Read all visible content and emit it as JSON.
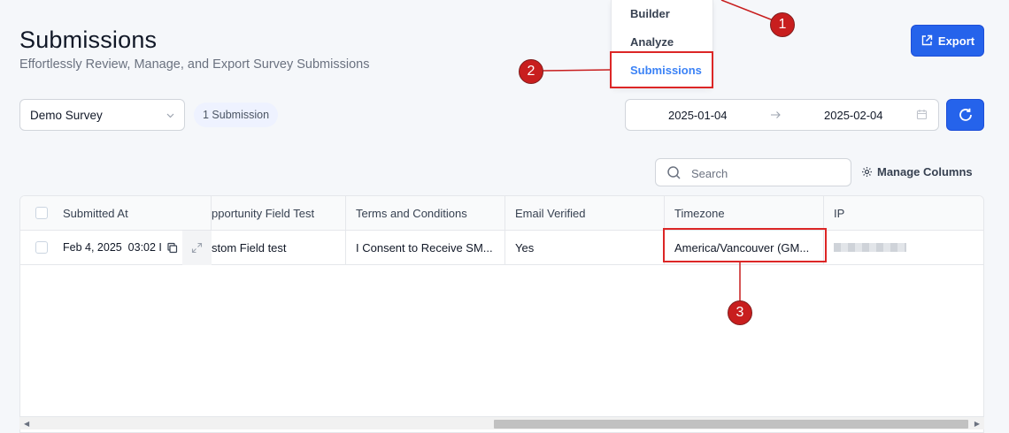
{
  "nav_menu": {
    "items": [
      "Builder",
      "Analyze",
      "Submissions"
    ],
    "active": "Submissions"
  },
  "header": {
    "title": "Submissions",
    "subtitle": "Effortlessly Review, Manage, and Export Survey Submissions",
    "export_label": "Export"
  },
  "filters": {
    "survey_selected": "Demo Survey",
    "submission_count": "1 Submission",
    "date_start": "2025-01-04",
    "date_end": "2025-02-04"
  },
  "search": {
    "placeholder": "Search"
  },
  "manage_columns_label": "Manage Columns",
  "table": {
    "columns": [
      "Submitted At",
      "pportunity Field Test",
      "Terms and Conditions",
      "Email Verified",
      "Timezone",
      "IP"
    ],
    "row": {
      "submitted_at": "Feb 4, 2025  03:02 I",
      "opportunity_field": "stom Field test",
      "terms": "I Consent to Receive SM...",
      "email_verified": "Yes",
      "timezone": "America/Vancouver (GM..."
    }
  },
  "annotations": {
    "marker_1": "1",
    "marker_2": "2",
    "marker_3": "3"
  },
  "colors": {
    "primary": "#2563eb",
    "annotation_red": "#dc2626",
    "active_nav": "#3b82f6"
  }
}
